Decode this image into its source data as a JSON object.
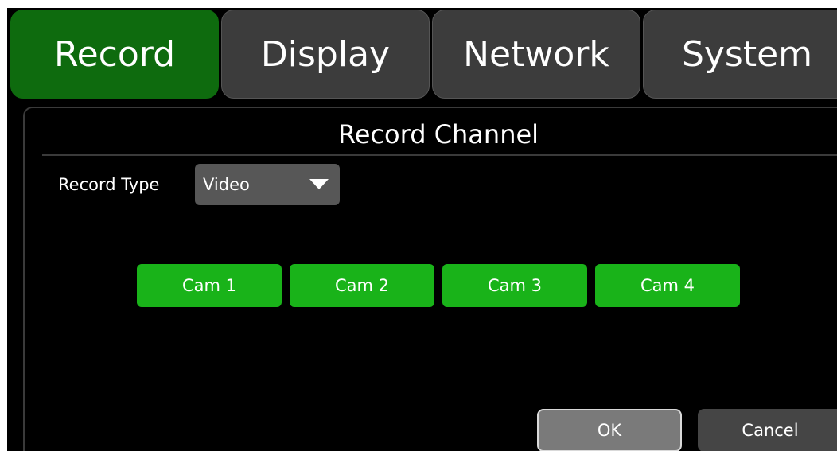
{
  "tabs": [
    {
      "label": "Record",
      "active": true
    },
    {
      "label": "Display",
      "active": false
    },
    {
      "label": "Network",
      "active": false
    },
    {
      "label": "System",
      "active": false
    }
  ],
  "panel": {
    "title": "Record Channel",
    "record_type": {
      "label": "Record Type",
      "value": "Video"
    },
    "cameras": [
      "Cam 1",
      "Cam 2",
      "Cam 3",
      "Cam 4"
    ],
    "ok_label": "OK",
    "cancel_label": "Cancel"
  },
  "colors": {
    "active_tab": "#0e6b0e",
    "inactive_tab": "#3c3c3c",
    "camera_button": "#19b319",
    "background": "#000000"
  }
}
